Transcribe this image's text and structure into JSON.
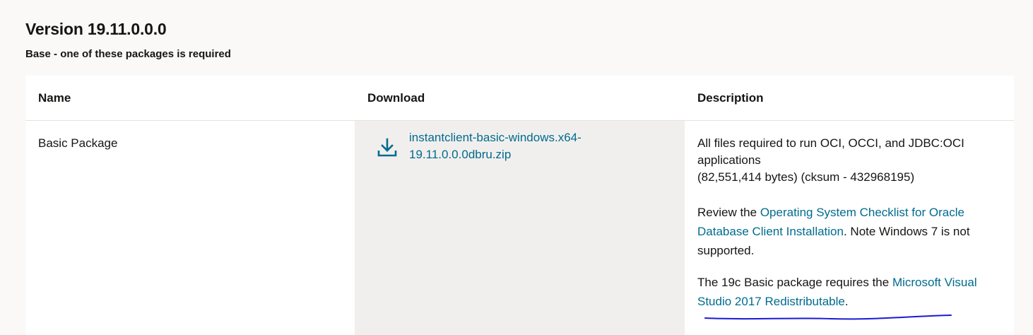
{
  "section": {
    "version_title": "Version 19.11.0.0.0",
    "subtitle": "Base - one of these packages is required"
  },
  "table": {
    "headers": {
      "name": "Name",
      "download": "Download",
      "description": "Description"
    },
    "row": {
      "name": "Basic Package",
      "download_icon": "download-icon",
      "download_link": "instantclient-basic-windows.x64-19.11.0.0.0dbru.zip",
      "description": {
        "line1": "All files required to run OCI, OCCI, and JDBC:OCI applications",
        "line2": "(82,551,414 bytes) (cksum - 432968195)",
        "review_prefix": "Review the ",
        "review_link": "Operating System Checklist for Oracle Database Client Installation",
        "review_suffix": ". Note Windows 7 is not supported.",
        "req_prefix": "The 19c Basic package requires the ",
        "req_link": "Microsoft Visual Studio 2017 Redistributable",
        "req_suffix": "."
      }
    }
  },
  "colors": {
    "link": "#006b8f",
    "download_bg": "#f1efed",
    "page_bg": "#fbf9f8",
    "annotation": "#1a1ad6"
  }
}
